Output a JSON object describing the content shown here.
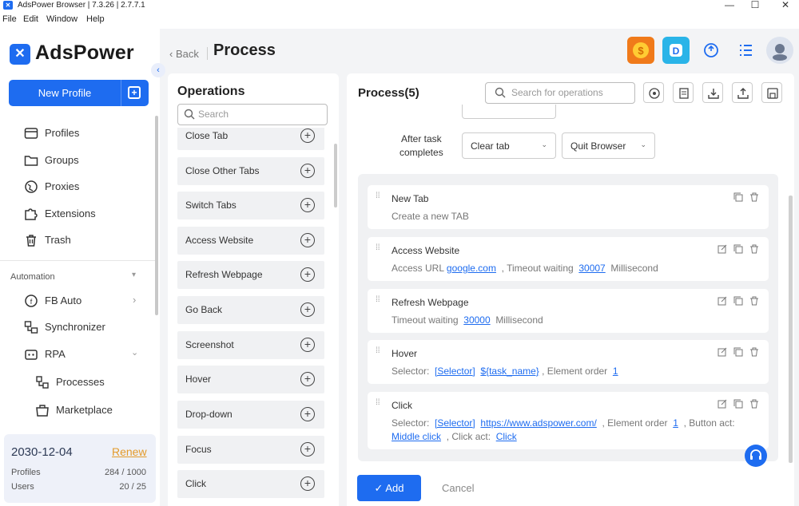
{
  "window": {
    "title": "AdsPower Browser | 7.3.26 | 2.7.7.1",
    "minimize": "—",
    "maximize": "☐",
    "close": "✕"
  },
  "menu": [
    "File",
    "Edit",
    "Window",
    "Help"
  ],
  "sidebar": {
    "brand": "AdsPower",
    "new_profile": "New Profile",
    "items": [
      {
        "label": "Profiles",
        "icon": "profiles-icon"
      },
      {
        "label": "Groups",
        "icon": "folder-icon"
      },
      {
        "label": "Proxies",
        "icon": "globe-icon"
      },
      {
        "label": "Extensions",
        "icon": "puzzle-icon"
      },
      {
        "label": "Trash",
        "icon": "trash-icon"
      }
    ],
    "automation_label": "Automation",
    "automation_items": [
      {
        "label": "FB Auto",
        "icon": "fb-auto-icon"
      },
      {
        "label": "Synchronizer",
        "icon": "synchronizer-icon"
      },
      {
        "label": "RPA",
        "icon": "rpa-icon"
      },
      {
        "label": "Processes",
        "icon": "processes-icon"
      },
      {
        "label": "Marketplace",
        "icon": "marketplace-icon"
      }
    ],
    "subscription": {
      "date": "2030-12-04",
      "renew": "Renew",
      "profiles_label": "Profiles",
      "profiles_value": "284 / 1000",
      "users_label": "Users",
      "users_value": "20 / 25"
    }
  },
  "header": {
    "back": "Back",
    "title": "Process"
  },
  "operations": {
    "title": "Operations",
    "search_placeholder": "Search",
    "items": [
      "Close Tab",
      "Close Other Tabs",
      "Switch Tabs",
      "Access Website",
      "Refresh Webpage",
      "Go Back",
      "Screenshot",
      "Hover",
      "Drop-down",
      "Focus",
      "Click"
    ]
  },
  "process": {
    "title": "Process(5)",
    "search_placeholder": "Search for operations",
    "after_task_label_1": "After task",
    "after_task_label_2": "completes",
    "select_1": "Clear tab",
    "select_2": "Quit Browser",
    "steps": {
      "s1": {
        "title": "New Tab",
        "desc": "Create a new TAB"
      },
      "s2": {
        "title": "Access Website",
        "p1": "Access URL",
        "url": "google.com",
        "p2": ", Timeout waiting",
        "timeout": "30007",
        "p3": "Millisecond"
      },
      "s3": {
        "title": "Refresh Webpage",
        "p1": "Timeout waiting",
        "timeout": "30000",
        "p2": "Millisecond"
      },
      "s4": {
        "title": "Hover",
        "p1": "Selector:",
        "selector_type": "[Selector]",
        "selector": "${task_name}",
        "p2": ", Element order",
        "order": "1"
      },
      "s5": {
        "title": "Click",
        "p1": "Selector:",
        "selector_type": "[Selector]",
        "selector": "https://www.adspower.com/",
        "p2": ", Element order",
        "order": "1",
        "p3": ", Button act:",
        "button_act": "Middle click",
        "p4": ", Click act:",
        "click_act": "Click"
      }
    },
    "add": "Add",
    "cancel": "Cancel"
  }
}
